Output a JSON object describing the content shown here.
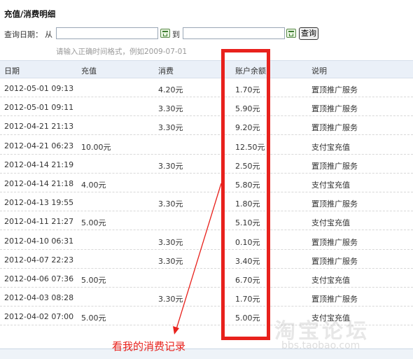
{
  "title": "充值/消费明细",
  "query": {
    "date_label": "查询日期：",
    "from_label": "从",
    "to_label": "到",
    "from_value": "",
    "to_value": "",
    "button_label": "查询",
    "hint": "请输入正确时间格式，例如2009-07-01"
  },
  "table": {
    "headers": [
      "日期",
      "充值",
      "消费",
      "账户余额",
      "说明"
    ],
    "rows": [
      [
        "2012-05-01 09:13",
        "",
        "4.20元",
        "1.70元",
        "置顶推广服务"
      ],
      [
        "2012-05-01 09:11",
        "",
        "3.30元",
        "5.90元",
        "置顶推广服务"
      ],
      [
        "2012-04-21 21:13",
        "",
        "3.30元",
        "9.20元",
        "置顶推广服务"
      ],
      [
        "2012-04-21 06:23",
        "10.00元",
        "",
        "12.50元",
        "支付宝充值"
      ],
      [
        "2012-04-14 21:19",
        "",
        "3.30元",
        "2.50元",
        "置顶推广服务"
      ],
      [
        "2012-04-14 21:18",
        "4.00元",
        "",
        "5.80元",
        "支付宝充值"
      ],
      [
        "2012-04-13 19:55",
        "",
        "3.30元",
        "1.80元",
        "置顶推广服务"
      ],
      [
        "2012-04-11 21:27",
        "5.00元",
        "",
        "5.10元",
        "支付宝充值"
      ],
      [
        "2012-04-10 06:31",
        "",
        "3.30元",
        "0.10元",
        "置顶推广服务"
      ],
      [
        "2012-04-07 22:23",
        "",
        "3.30元",
        "3.40元",
        "置顶推广服务"
      ],
      [
        "2012-04-06 07:36",
        "5.00元",
        "",
        "6.70元",
        "支付宝充值"
      ],
      [
        "2012-04-03 08:28",
        "",
        "3.30元",
        "1.70元",
        "置顶推广服务"
      ],
      [
        "2012-04-02 07:00",
        "5.00元",
        "",
        "5.00元",
        "支付宝充值"
      ]
    ]
  },
  "annotation": {
    "text": "看我的消费记录",
    "color": "#e8211c"
  },
  "watermark": {
    "text": "淘宝论坛",
    "url": "bbs.taobao.com"
  }
}
